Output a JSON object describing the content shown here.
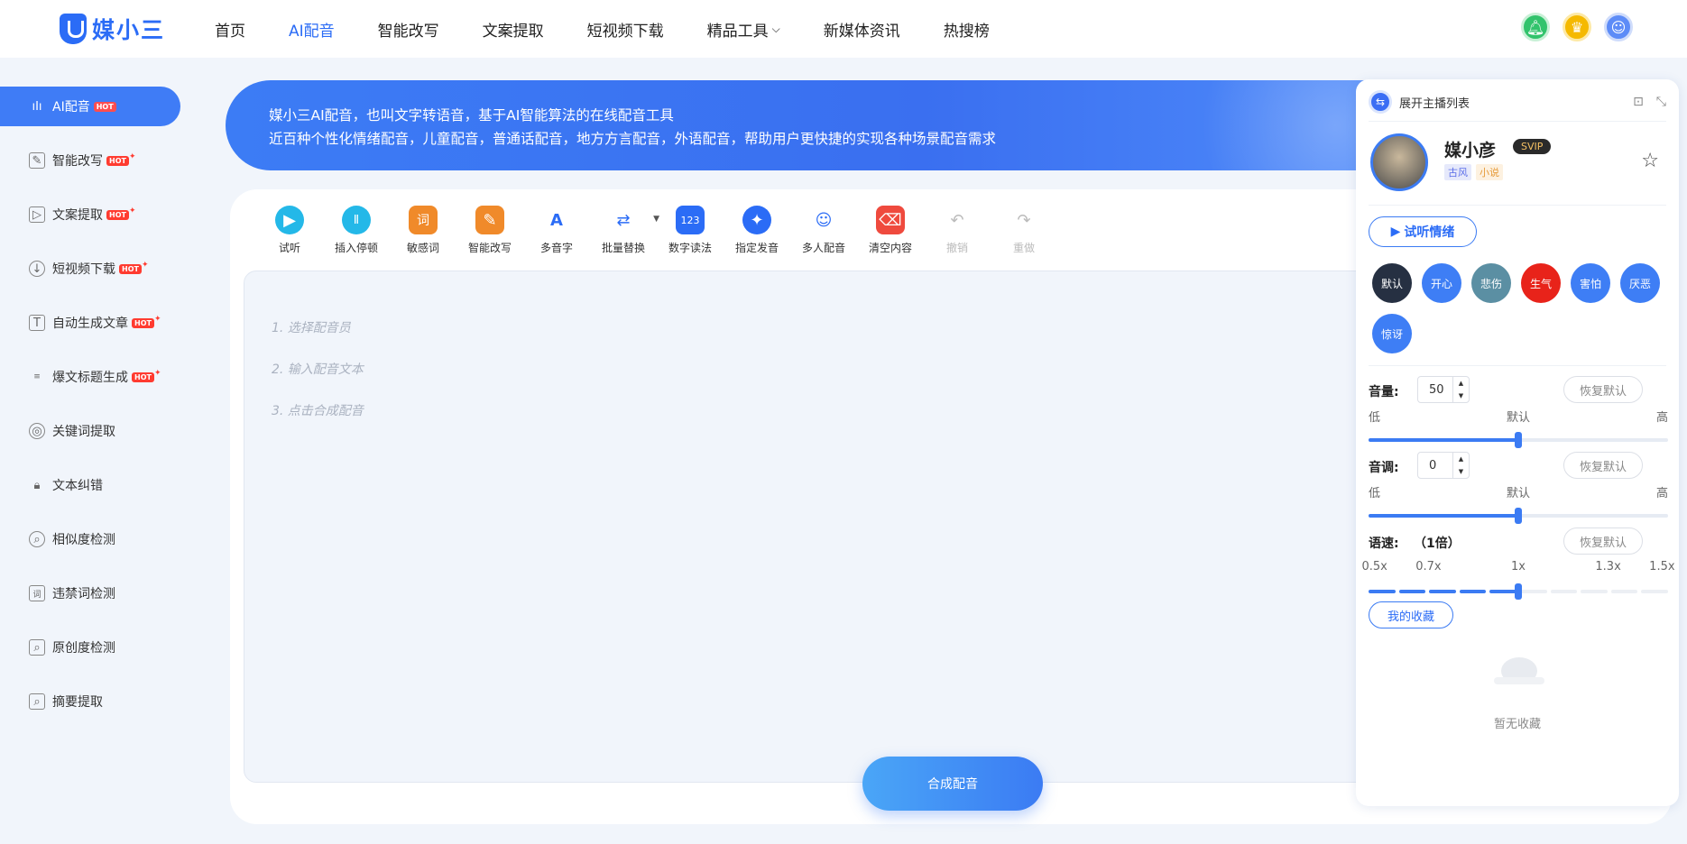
{
  "brand": {
    "logo_text": "媒小三"
  },
  "nav": {
    "items": [
      {
        "label": "首页"
      },
      {
        "label": "AI配音",
        "active": true
      },
      {
        "label": "智能改写"
      },
      {
        "label": "文案提取"
      },
      {
        "label": "短视频下载"
      },
      {
        "label": "精品工具",
        "has_dropdown": true
      },
      {
        "label": "新媒体资讯"
      },
      {
        "label": "热搜榜"
      }
    ],
    "icons": [
      "bell-icon",
      "crown-icon",
      "user-avatar"
    ]
  },
  "sidebar": {
    "hot_label": "HOT",
    "items": [
      {
        "label": "AI配音",
        "icon": "audio-wave-icon",
        "hot": true,
        "active": true
      },
      {
        "label": "智能改写",
        "icon": "edit-icon",
        "hot": true
      },
      {
        "label": "文案提取",
        "icon": "video-text-icon",
        "hot": true
      },
      {
        "label": "短视频下载",
        "icon": "cloud-download-icon",
        "hot": true
      },
      {
        "label": "自动生成文章",
        "icon": "text-t-icon",
        "hot": true
      },
      {
        "label": "爆文标题生成",
        "icon": "title-icon",
        "hot": true
      },
      {
        "label": "关键词提取",
        "icon": "target-icon",
        "hot": false
      },
      {
        "label": "文本纠错",
        "icon": "lock-icon",
        "hot": false
      },
      {
        "label": "相似度检测",
        "icon": "similarity-icon",
        "hot": false
      },
      {
        "label": "违禁词检测",
        "icon": "forbidden-word-icon",
        "hot": false
      },
      {
        "label": "原创度检测",
        "icon": "original-check-icon",
        "hot": false
      },
      {
        "label": "摘要提取",
        "icon": "summary-icon",
        "hot": false
      }
    ]
  },
  "banner": {
    "line1": "媒小三AI配音，也叫文字转语音，基于AI智能算法的在线配音工具",
    "line2": "近百种个性化情绪配音，儿童配音，普通话配音，地方方言配音，外语配音，帮助用户更快捷的实现各种场景配音需求"
  },
  "toolbar": {
    "tools": [
      {
        "label": "试听",
        "icon": "play-icon",
        "glyph": "▶"
      },
      {
        "label": "插入停顿",
        "icon": "pause-icon",
        "glyph": "Ⅱ"
      },
      {
        "label": "敏感词",
        "icon": "sensitive-word-icon",
        "glyph": "词"
      },
      {
        "label": "智能改写",
        "icon": "rewrite-icon",
        "glyph": "✎"
      },
      {
        "label": "多音字",
        "icon": "polyphone-icon",
        "glyph": "A"
      },
      {
        "label": "批量替换",
        "icon": "batch-replace-icon",
        "glyph": "⇄"
      },
      {
        "label": "数字读法",
        "icon": "number-reading-icon",
        "glyph": "123"
      },
      {
        "label": "指定发音",
        "icon": "pronunciation-icon",
        "glyph": "✦"
      },
      {
        "label": "多人配音",
        "icon": "multi-voice-icon",
        "glyph": "☺"
      },
      {
        "label": "清空内容",
        "icon": "broom-icon",
        "glyph": "⌫"
      },
      {
        "label": "撤销",
        "icon": "undo-icon",
        "glyph": "↶",
        "disabled": true
      },
      {
        "label": "重做",
        "icon": "redo-icon",
        "glyph": "↷",
        "disabled": true
      }
    ]
  },
  "editor": {
    "steps": [
      "1. 选择配音员",
      "2. 输入配音文本",
      "3. 点击合成配音"
    ]
  },
  "synthesize_button": "合成配音",
  "panel": {
    "header_title": "展开主播列表",
    "anchor": {
      "name": "媒小彦",
      "badge": "SVIP",
      "tags": [
        "古风",
        "小说"
      ]
    },
    "try_button": "试听情绪",
    "emotions": [
      {
        "label": "默认",
        "color": "#263042"
      },
      {
        "label": "开心",
        "color": "#3e7ef5"
      },
      {
        "label": "悲伤",
        "color": "#5b8fa3"
      },
      {
        "label": "生气",
        "color": "#e8231a"
      },
      {
        "label": "害怕",
        "color": "#3e7ef5"
      },
      {
        "label": "厌恶",
        "color": "#3e7ef5"
      },
      {
        "label": "惊讶",
        "color": "#3e7ef5"
      }
    ],
    "volume": {
      "label": "音量:",
      "value": "50",
      "reset": "恢复默认",
      "low": "低",
      "mid": "默认",
      "high": "高",
      "level": 0.5
    },
    "pitch": {
      "label": "音调:",
      "value": "0",
      "reset": "恢复默认",
      "low": "低",
      "mid": "默认",
      "high": "高",
      "level": 0.5
    },
    "speed": {
      "label": "语速:",
      "value": "（1倍）",
      "reset": "恢复默认",
      "ticks": [
        "0.5x",
        "0.7x",
        "1x",
        "1.3x",
        "1.5x"
      ],
      "level": 0.5
    },
    "favorites_button": "我的收藏",
    "empty_text": "暂无收藏"
  }
}
